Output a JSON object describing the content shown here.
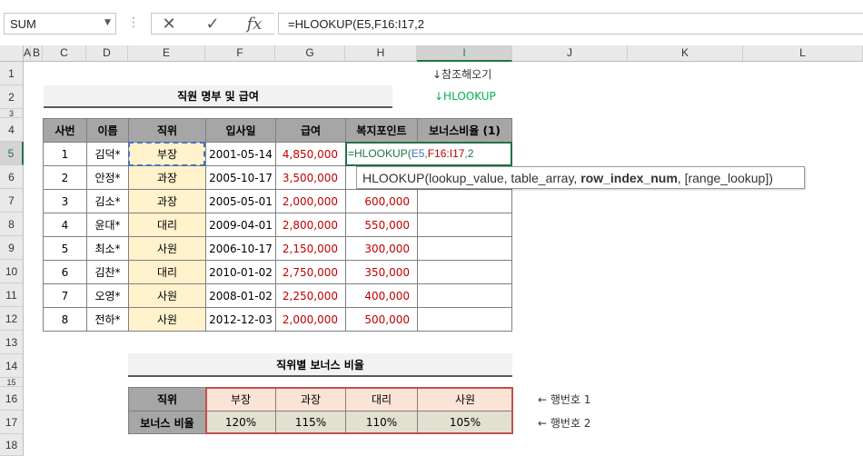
{
  "formula_bar": {
    "name_box": "SUM",
    "cancel_icon": "✕",
    "enter_icon": "✓",
    "fx_label": "fx",
    "formula": "=HLOOKUP(E5,F16:I17,2"
  },
  "columns": [
    "A",
    "B",
    "C",
    "D",
    "E",
    "F",
    "G",
    "H",
    "I",
    "J",
    "K",
    "L"
  ],
  "rows": [
    "1",
    "2",
    "3",
    "4",
    "5",
    "6",
    "7",
    "8",
    "9",
    "10",
    "11",
    "12",
    "13",
    "14",
    "15",
    "16",
    "17",
    "18"
  ],
  "notes": {
    "ref_note": "↓참조해오기",
    "hlookup_note": "↓HLOOKUP",
    "row1_note": "← 행번호 1",
    "row2_note": "← 행번호 2"
  },
  "employee_table": {
    "title": "직원 명부 및 급여",
    "headers": [
      "사번",
      "이름",
      "직위",
      "입사일",
      "급여",
      "복지포인트",
      "보너스비율 (1)"
    ],
    "rows": [
      [
        "1",
        "김덕*",
        "부장",
        "2001-05-14",
        "4,850,000",
        ""
      ],
      [
        "2",
        "안정*",
        "과장",
        "2005-10-17",
        "3,500,000",
        ""
      ],
      [
        "3",
        "김소*",
        "과장",
        "2005-05-01",
        "2,000,000",
        "600,000"
      ],
      [
        "4",
        "윤대*",
        "대리",
        "2009-04-01",
        "2,800,000",
        "550,000"
      ],
      [
        "5",
        "최소*",
        "사원",
        "2006-10-17",
        "2,150,000",
        "300,000"
      ],
      [
        "6",
        "김찬*",
        "대리",
        "2010-01-02",
        "2,750,000",
        "350,000"
      ],
      [
        "7",
        "오영*",
        "사원",
        "2008-01-02",
        "2,250,000",
        "400,000"
      ],
      [
        "8",
        "전하*",
        "사원",
        "2012-12-03",
        "2,000,000",
        "500,000"
      ]
    ],
    "editing_cell": {
      "prefix": "=HLOOKUP(",
      "ref1": "E5",
      "sep": ",",
      "ref2": "F16:I17",
      "suffix": ",2"
    }
  },
  "tooltip": {
    "func": "HLOOKUP(",
    "arg1": "lookup_value, table_array, ",
    "arg_bold": "row_index_num",
    "arg_rest": ", [range_lookup])"
  },
  "bonus_table": {
    "title": "직위별 보너스 비율",
    "row_label_1": "직위",
    "row_label_2": "보너스 비율",
    "positions": [
      "부장",
      "과장",
      "대리",
      "사원"
    ],
    "rates": [
      "120%",
      "115%",
      "110%",
      "105%"
    ]
  }
}
